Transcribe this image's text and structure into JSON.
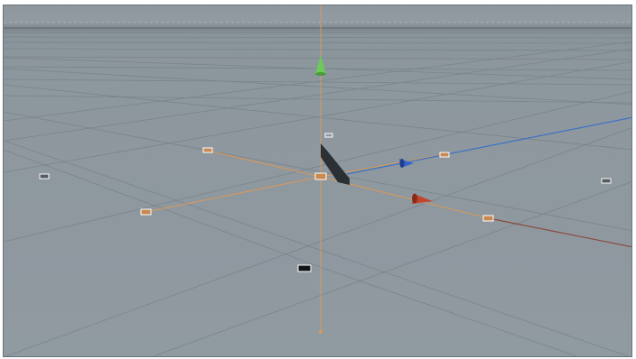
{
  "viewport": {
    "kind": "3d-perspective-view",
    "colors": {
      "background": "#8f989f",
      "grid_line": "#7b848b",
      "grid_line_major": "#6a737a",
      "horizon": "#9aa3aa",
      "y_axis": "#d79a62",
      "x_axis_handle": "#b0402a",
      "y_axis_handle": "#5fbf4a",
      "z_axis_handle": "#2f5cc8",
      "z_axis_line": "#3c73c6",
      "x_axis_line": "#8a4a3e",
      "selection_outline": "#d8985a"
    },
    "icons": {
      "y_handle": "green-cone-icon",
      "x_handle": "red-cone-icon",
      "z_handle": "blue-cone-icon",
      "object": "plane-object-icon"
    }
  }
}
